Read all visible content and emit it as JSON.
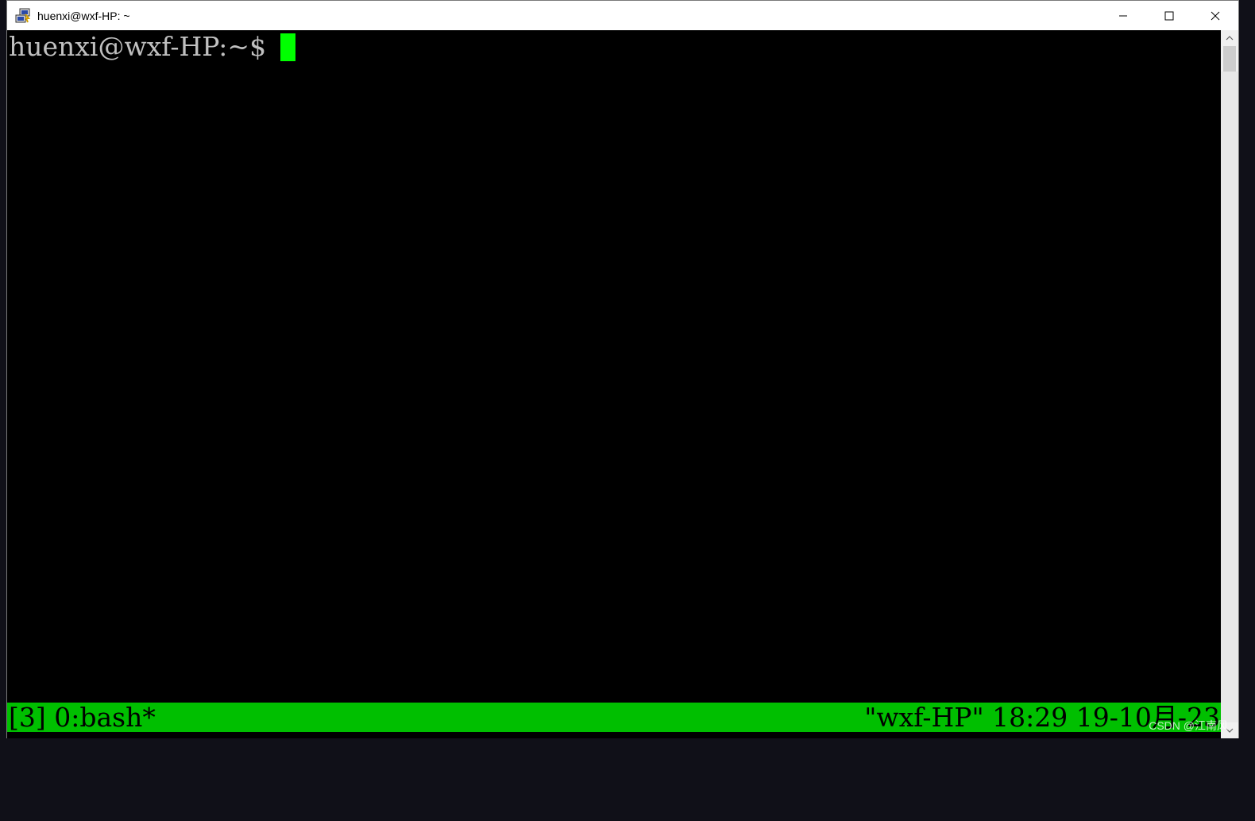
{
  "window": {
    "title": "huenxi@wxf-HP: ~",
    "icons": {
      "app": "putty-icon",
      "minimize": "minimize-icon",
      "maximize": "maximize-icon",
      "close": "close-icon"
    }
  },
  "terminal": {
    "prompt": "huenxi@wxf-HP:~$",
    "cursor_color": "#00ff00",
    "text_color": "#c0c0c0",
    "background": "#000000"
  },
  "statusbar": {
    "left": "[3] 0:bash*",
    "right": "\"wxf-HP\" 18:29 19-10月-23",
    "color": "#00bf00"
  },
  "scrollbar": {
    "icons": {
      "up": "scroll-up-arrow-icon",
      "down": "scroll-down-arrow-icon"
    }
  },
  "watermark": "CSDN @江南风"
}
